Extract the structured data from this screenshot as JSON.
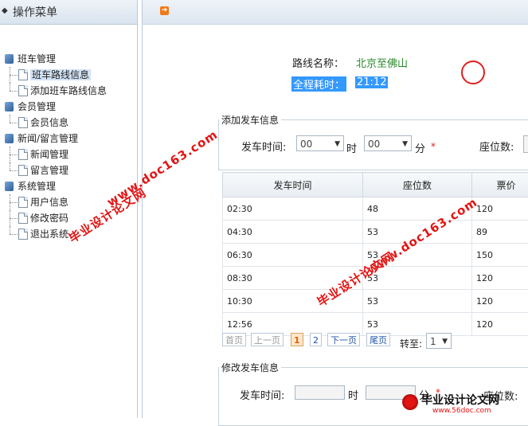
{
  "sidebar": {
    "title": "操作菜单",
    "groups": [
      {
        "label": "班车管理",
        "items": [
          "班车路线信息",
          "添加班车路线信息"
        ]
      },
      {
        "label": "会员管理",
        "items": [
          "会员信息"
        ]
      },
      {
        "label": "新闻/留言管理",
        "items": [
          "新闻管理",
          "留言管理"
        ]
      },
      {
        "label": "系统管理",
        "items": [
          "用户信息",
          "修改密码",
          "退出系统"
        ]
      }
    ]
  },
  "route": {
    "name_label": "路线名称：",
    "name_value": "北京至佛山",
    "duration_label": "全程耗时：",
    "duration_value": "21:12"
  },
  "add_form": {
    "legend": "添加发车信息",
    "time_label": "发车时间:",
    "hour_value": "00",
    "hour_unit": "时",
    "minute_value": "00",
    "minute_unit": "分",
    "required_mark": "*",
    "seats_label": "座位数:"
  },
  "table": {
    "headers": [
      "发车时间",
      "座位数",
      "票价"
    ],
    "rows": [
      [
        "02:30",
        "48",
        "120"
      ],
      [
        "04:30",
        "53",
        "89"
      ],
      [
        "06:30",
        "53",
        "150"
      ],
      [
        "08:30",
        "53",
        "120"
      ],
      [
        "10:30",
        "53",
        "120"
      ],
      [
        "12:56",
        "53",
        "120"
      ]
    ]
  },
  "pagination": {
    "first": "首页",
    "prev": "上一页",
    "page1": "1",
    "page2": "2",
    "next": "下一页",
    "last": "尾页",
    "jump_label": "转至:",
    "jump_value": "1"
  },
  "edit_form": {
    "legend": "修改发车信息",
    "time_label": "发车时间:",
    "hour_unit": "时",
    "minute_unit": "分",
    "required_mark": "*",
    "seats_label": "座位数:"
  },
  "watermarks": {
    "url": "www.doc163.com",
    "text": "毕业设计论文网"
  },
  "logo": {
    "title": "毕业设计论文网",
    "url": "www.56doc.com"
  },
  "colors": {
    "route_value": "#2a8a2a",
    "highlight": "#3399ff",
    "watermark": "#e31414",
    "current_page": "#e06000"
  }
}
